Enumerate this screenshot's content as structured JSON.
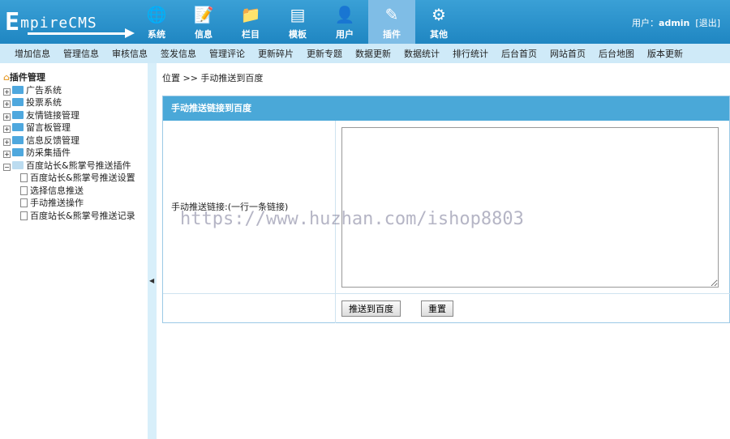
{
  "logo": {
    "first": "E",
    "rest": "mpireCMS"
  },
  "modules": [
    {
      "label": "系统",
      "icon": "globe-icon",
      "glyph": "🌐"
    },
    {
      "label": "信息",
      "icon": "document-edit-icon",
      "glyph": "📝"
    },
    {
      "label": "栏目",
      "icon": "folder-icon",
      "glyph": "📁"
    },
    {
      "label": "模板",
      "icon": "window-icon",
      "glyph": "▤"
    },
    {
      "label": "用户",
      "icon": "user-icon",
      "glyph": "👤"
    },
    {
      "label": "插件",
      "icon": "tools-icon",
      "glyph": "✎",
      "active": true
    },
    {
      "label": "其他",
      "icon": "gear-icon",
      "glyph": "⚙"
    }
  ],
  "user": {
    "prefix": "用户：",
    "name": "admin",
    "logout": "[退出]"
  },
  "nav": [
    "增加信息",
    "管理信息",
    "审核信息",
    "签发信息",
    "管理评论",
    "更新碎片",
    "更新专题",
    "数据更新",
    "数据统计",
    "排行统计",
    "后台首页",
    "网站首页",
    "后台地图",
    "版本更新"
  ],
  "sidebar": {
    "root": "插件管理",
    "folders": [
      "广告系统",
      "投票系统",
      "友情链接管理",
      "留言板管理",
      "信息反馈管理",
      "防采集插件"
    ],
    "open_folder": "百度站长&熊掌号推送插件",
    "children": [
      "百度站长&熊掌号推送设置",
      "选择信息推送",
      "手动推送操作",
      "百度站长&熊掌号推送记录"
    ]
  },
  "breadcrumb": "位置 >> 手动推送到百度",
  "form": {
    "title": "手动推送链接到百度",
    "field_label": "手动推送链接:(一行一条链接)",
    "textarea_value": "",
    "submit": "推送到百度",
    "reset": "重置"
  },
  "watermark": "https://www.huzhan.com/ishop8803"
}
